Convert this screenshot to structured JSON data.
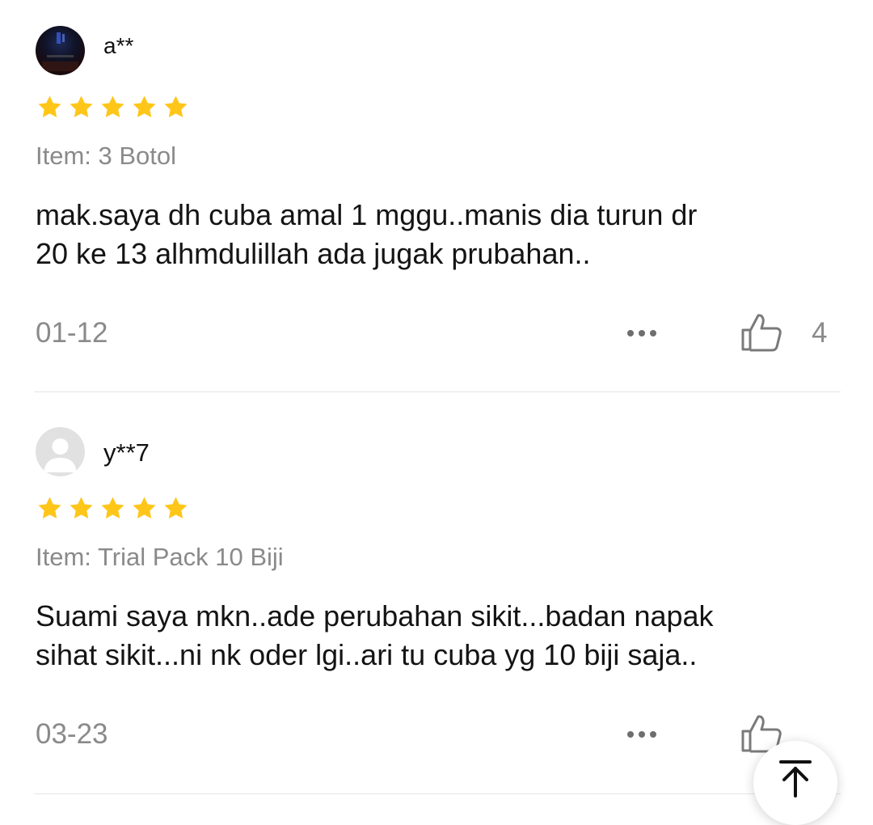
{
  "reviews": [
    {
      "username": "a**",
      "rating": 5,
      "item": "Item: 3 Botol",
      "text_line1": "mak.saya dh cuba amal 1 mggu..manis dia turun dr",
      "text_line2": "20 ke 13 alhmdulillah ada jugak prubahan..",
      "date": "01-12",
      "likes": "4"
    },
    {
      "username": "y**7",
      "rating": 5,
      "item": "Item: Trial Pack 10 Biji",
      "text_line1": "Suami saya mkn..ade perubahan sikit...badan napak",
      "text_line2": "sihat sikit...ni nk oder lgi..ari tu cuba yg 10 biji saja..",
      "date": "03-23"
    }
  ],
  "icons": {
    "star": "star-icon",
    "more": "more-dots-icon",
    "like": "thumbs-up-icon",
    "back_to_top": "arrow-up-to-top-icon"
  },
  "colors": {
    "star": "#FFC61A",
    "muted_text": "#8A8A8A",
    "divider": "#E6E6E6"
  }
}
